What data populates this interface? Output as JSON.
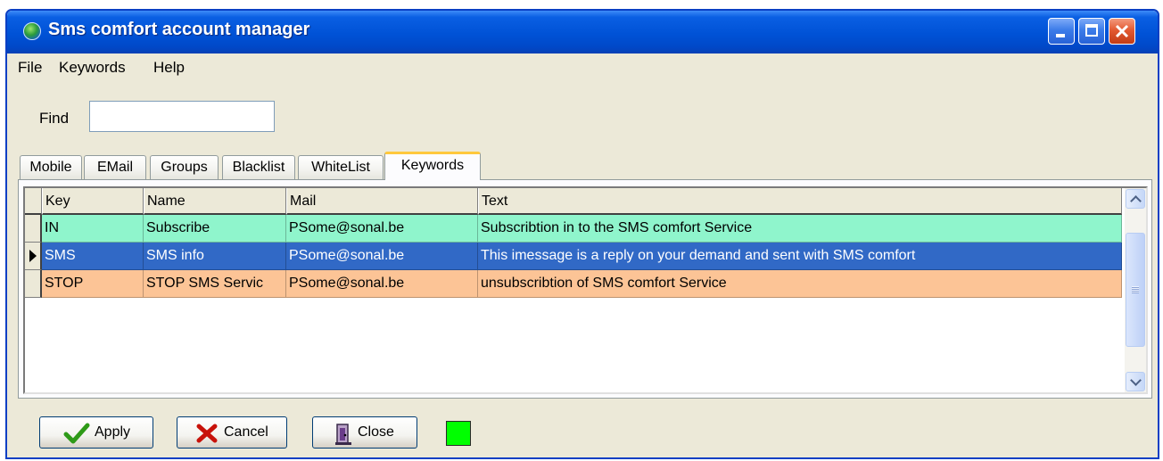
{
  "window": {
    "title": "Sms comfort account manager"
  },
  "menu": [
    "File",
    "Keywords",
    "Help"
  ],
  "find": {
    "label": "Find",
    "value": ""
  },
  "tabs": [
    {
      "label": "Mobile",
      "active": false
    },
    {
      "label": "EMail",
      "active": false
    },
    {
      "label": "Groups",
      "active": false
    },
    {
      "label": "Blacklist",
      "active": false
    },
    {
      "label": "WhiteList",
      "active": false
    },
    {
      "label": "Keywords",
      "active": true
    }
  ],
  "grid": {
    "columns": [
      "Key",
      "Name",
      "Mail",
      "Text"
    ],
    "rows": [
      {
        "key": "IN",
        "name": "Subscribe",
        "mail": "PSome@sonal.be",
        "text": "Subscribtion in to the SMS comfort Service",
        "background": "#8ff5cc",
        "color": "#000000",
        "current": false
      },
      {
        "key": "SMS",
        "name": "SMS info",
        "mail": "PSome@sonal.be",
        "text": "This imessage is a reply on your demand and sent with SMS comfort",
        "background": "#3169c6",
        "color": "#ffffff",
        "current": true
      },
      {
        "key": "STOP",
        "name": "STOP SMS Servic",
        "mail": "PSome@sonal.be",
        "text": "unsubscribtion of SMS comfort Service",
        "background": "#fcc496",
        "color": "#000000",
        "current": false
      }
    ]
  },
  "buttons": {
    "apply": "Apply",
    "cancel": "Cancel",
    "close": "Close"
  },
  "colors": {
    "titlebar": "#0052d6",
    "status_indicator": "#00ff00",
    "window_bg": "#ece9d8"
  },
  "icons": {
    "apply": "check-icon",
    "cancel": "x-icon",
    "close": "door-icon",
    "app": "globe-icon"
  }
}
